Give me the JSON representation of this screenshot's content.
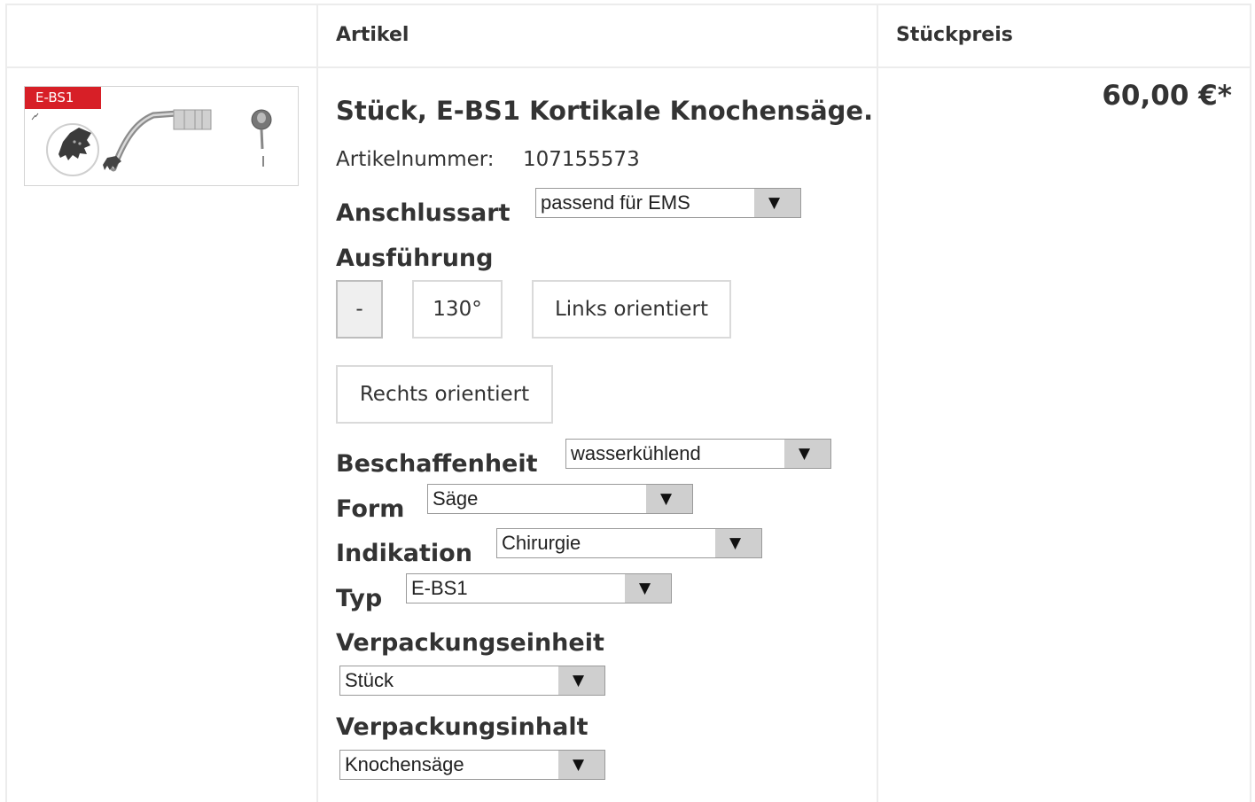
{
  "table": {
    "headers": {
      "artikel": "Artikel",
      "stueckpreis": "Stückpreis"
    }
  },
  "product": {
    "badge": "E-BS1",
    "title": "Stück, E-BS1 Kortikale Knochensäge.",
    "artikelnummer_label": "Artikelnummer:",
    "artikelnummer": "107155573",
    "price": "60,00 €*"
  },
  "options": {
    "anschlussart": {
      "label": "Anschlussart",
      "value": "passend für EMS"
    },
    "ausfuehrung": {
      "label": "Ausführung",
      "buttons": [
        "-",
        "130°",
        "Links orientiert",
        "Rechts orientiert"
      ],
      "selected": "-"
    },
    "beschaffenheit": {
      "label": "Beschaffenheit",
      "value": "wasserkühlend"
    },
    "form": {
      "label": "Form",
      "value": "Säge"
    },
    "indikation": {
      "label": "Indikation",
      "value": "Chirurgie"
    },
    "typ": {
      "label": "Typ",
      "value": "E-BS1"
    },
    "verpackungseinheit": {
      "label": "Verpackungseinheit",
      "value": "Stück"
    },
    "verpackungsinhalt": {
      "label": "Verpackungsinhalt",
      "value": "Knochensäge"
    }
  },
  "colors": {
    "badge": "#d71f27",
    "border": "#ececec",
    "dropdown_arrow_bg": "#cfcfcf",
    "selected_button": "#efefef"
  },
  "icons": {
    "dropdown": "triangle-down-icon"
  }
}
